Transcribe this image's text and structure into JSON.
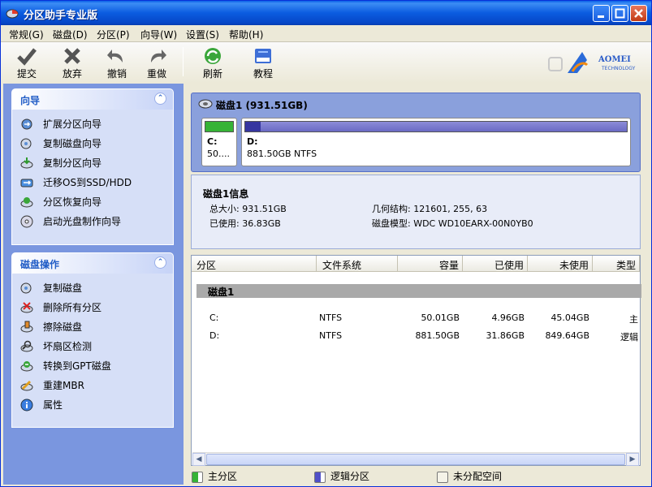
{
  "window": {
    "title": "分区助手专业版"
  },
  "menu": [
    "常规(G)",
    "磁盘(D)",
    "分区(P)",
    "向导(W)",
    "设置(S)",
    "帮助(H)"
  ],
  "toolbar": [
    {
      "label": "提交",
      "icon": "check-icon"
    },
    {
      "label": "放弃",
      "icon": "x-icon"
    },
    {
      "label": "撤销",
      "icon": "undo-icon"
    },
    {
      "label": "重做",
      "icon": "redo-icon"
    },
    {
      "label": "刷新",
      "icon": "refresh-icon"
    },
    {
      "label": "教程",
      "icon": "book-icon"
    }
  ],
  "logo": {
    "brand": "AOMEI",
    "sub": "TECHNOLOGY"
  },
  "wizard_panel": {
    "title": "向导",
    "items": [
      "扩展分区向导",
      "复制磁盘向导",
      "复制分区向导",
      "迁移OS到SSD/HDD",
      "分区恢复向导",
      "启动光盘制作向导"
    ]
  },
  "disk_ops_panel": {
    "title": "磁盘操作",
    "items": [
      "复制磁盘",
      "删除所有分区",
      "擦除磁盘",
      "坏扇区检测",
      "转换到GPT磁盘",
      "重建MBR",
      "属性"
    ]
  },
  "disk_map": {
    "title": "磁盘1 (931.51GB)",
    "partitions": [
      {
        "name": "C:",
        "size": "50....",
        "fill": 1.0
      },
      {
        "name": "D:",
        "size": "881.50GB NTFS",
        "fill": 0.04
      }
    ]
  },
  "disk_info": {
    "title": "磁盘1信息",
    "total": "总大小: 931.51GB",
    "used": "已使用: 36.83GB",
    "geometry": "几何结构: 121601, 255, 63",
    "model": "磁盘模型: WDC WD10EARX-00N0YB0"
  },
  "table": {
    "headers": [
      "分区",
      "文件系统",
      "容量",
      "已使用",
      "未使用",
      "类型"
    ],
    "disk_label": "磁盘1",
    "rows": [
      [
        "C:",
        "NTFS",
        "50.01GB",
        "4.96GB",
        "45.04GB",
        "主"
      ],
      [
        "D:",
        "NTFS",
        "881.50GB",
        "31.86GB",
        "849.64GB",
        "逻辑"
      ]
    ]
  },
  "legend": [
    "主分区",
    "逻辑分区",
    "未分配空间"
  ],
  "colors": {
    "primary": "#36b336",
    "logical": "#5050c8",
    "unallocated": "#f5f3e8",
    "accent": "#215dc6"
  }
}
